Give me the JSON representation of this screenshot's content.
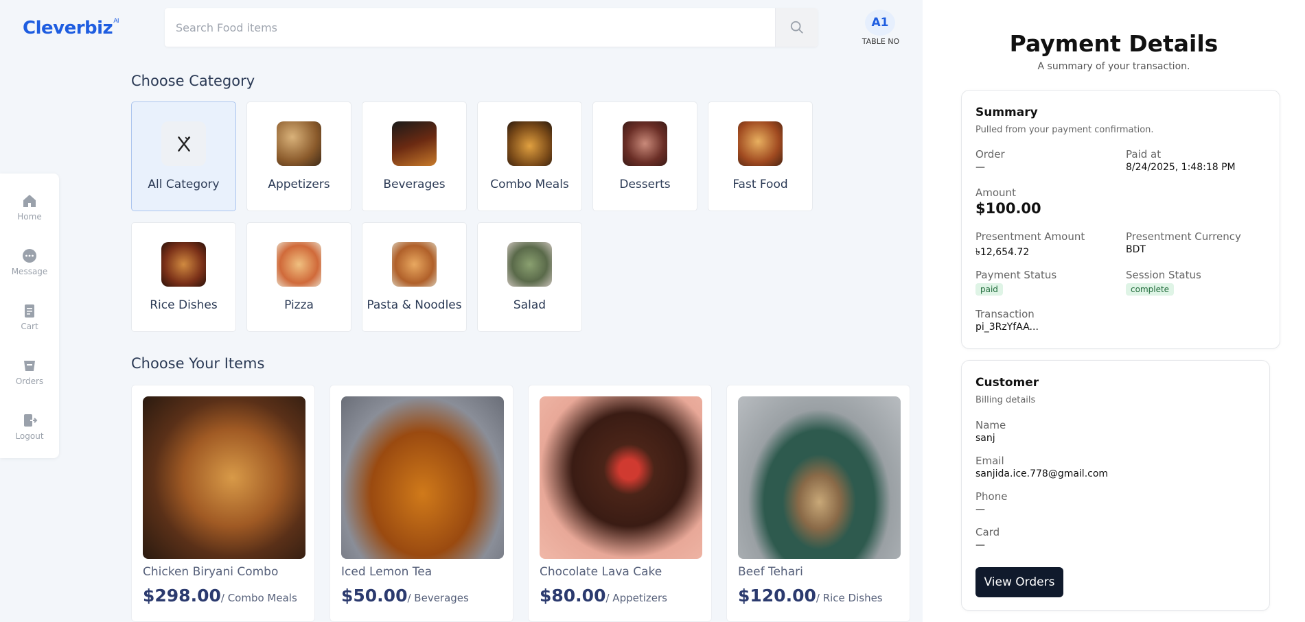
{
  "logo": {
    "text": "Cleverbiz",
    "sup": "AI"
  },
  "search": {
    "placeholder": "Search Food items"
  },
  "table": {
    "number": "A1",
    "label": "TABLE NO"
  },
  "nav": [
    {
      "label": "Home",
      "icon": "home-icon"
    },
    {
      "label": "Message",
      "icon": "message-icon"
    },
    {
      "label": "Cart",
      "icon": "cart-icon"
    },
    {
      "label": "Orders",
      "icon": "orders-icon"
    },
    {
      "label": "Logout",
      "icon": "logout-icon"
    }
  ],
  "categories_title": "Choose Category",
  "categories": [
    {
      "label": "All Category"
    },
    {
      "label": "Appetizers"
    },
    {
      "label": "Beverages"
    },
    {
      "label": "Combo Meals"
    },
    {
      "label": "Desserts"
    },
    {
      "label": "Fast Food"
    },
    {
      "label": "Rice Dishes"
    },
    {
      "label": "Pizza"
    },
    {
      "label": "Pasta & Noodles"
    },
    {
      "label": "Salad"
    }
  ],
  "items_title": "Choose Your Items",
  "items": [
    {
      "name": "Chicken Biryani Combo",
      "price": "$298.00",
      "category": "/ Combo Meals"
    },
    {
      "name": "Iced Lemon Tea",
      "price": "$50.00",
      "category": "/ Beverages"
    },
    {
      "name": "Chocolate Lava Cake",
      "price": "$80.00",
      "category": "/ Appetizers"
    },
    {
      "name": "Beef Tehari",
      "price": "$120.00",
      "category": "/ Rice Dishes"
    }
  ],
  "payment": {
    "title": "Payment Details",
    "subtitle": "A summary of your transaction.",
    "summary": {
      "title": "Summary",
      "subtitle": "Pulled from your payment confirmation.",
      "order_label": "Order",
      "order_value": "—",
      "paid_at_label": "Paid at",
      "paid_at_value": "8/24/2025, 1:48:18 PM",
      "amount_label": "Amount",
      "amount_value": "$100.00",
      "pres_amount_label": "Presentment Amount",
      "pres_amount_value": "৳12,654.72",
      "pres_currency_label": "Presentment Currency",
      "pres_currency_value": "BDT",
      "payment_status_label": "Payment Status",
      "payment_status_value": "paid",
      "session_status_label": "Session Status",
      "session_status_value": "complete",
      "transaction_label": "Transaction",
      "transaction_value": "pi_3RzYfAA..."
    },
    "customer": {
      "title": "Customer",
      "subtitle": "Billing details",
      "name_label": "Name",
      "name_value": "sanj",
      "email_label": "Email",
      "email_value": "sanjida.ice.778@gmail.com",
      "phone_label": "Phone",
      "phone_value": "—",
      "card_label": "Card",
      "card_value": "—",
      "button": "View Orders"
    }
  }
}
